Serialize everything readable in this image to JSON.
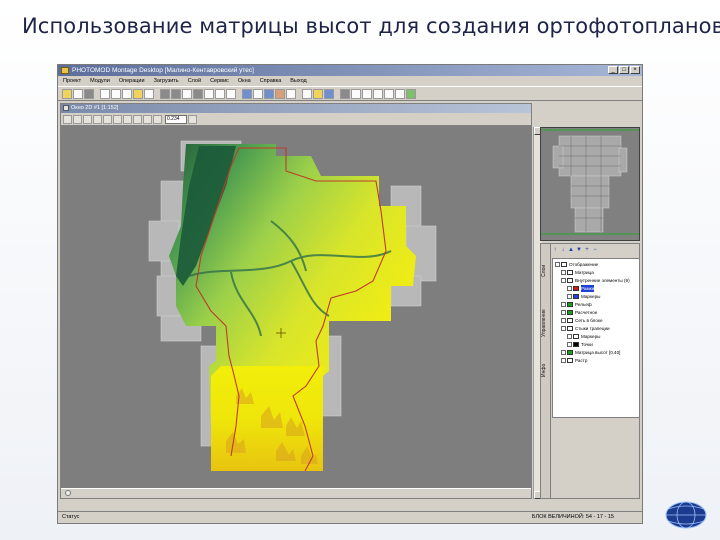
{
  "slide": {
    "title": "Использование матрицы высот для создания ортофотопланов"
  },
  "app": {
    "window_title": "PHOTOMOD Montage Desktop [Малино-Кентавровский утес]",
    "menu": [
      "Проект",
      "Модули",
      "Операции",
      "Загрузить",
      "Слой",
      "Сервис",
      "Окна",
      "Справка",
      "Выход"
    ],
    "doc_title": "Окно 2D #1 [1:152]",
    "zoom_value": "0.234",
    "status_left": "Статус",
    "status_right": "БЛОК ВЕЛИЧИНОЙ: 54 - 17 - 15",
    "layers_tab_labels": [
      "Слои",
      "Управление",
      "Инфо"
    ],
    "layers": [
      {
        "label": "Отображение",
        "color": "#ffffff"
      },
      {
        "label": "Матрица",
        "color": "#ffffff"
      },
      {
        "label": "Внутренние элементы (9)",
        "color": "#ffffff"
      },
      {
        "label": "Рамки",
        "color": "#d11a1a"
      },
      {
        "label": "Маркеры",
        "color": "#1f3fd6"
      },
      {
        "label": "Рельеф",
        "color": "#1aa01a"
      },
      {
        "label": "Расчетное",
        "color": "#1aa01a"
      },
      {
        "label": "Сеть в блоке",
        "color": "#ffffff"
      },
      {
        "label": "Стыки трапеции",
        "color": "#ffffff"
      },
      {
        "label": "Маркеры",
        "color": "#ffffff"
      },
      {
        "label": "Точки",
        "color": "#ffffff"
      },
      {
        "label": "Матрица высот [0.40]",
        "color": "#1aa01a"
      },
      {
        "label": "Растр",
        "color": "#ffffff"
      }
    ]
  },
  "colors": {
    "title_text": "#1d2447",
    "accent_window": "#5c6e9a",
    "boundary": "#c03a2a"
  }
}
